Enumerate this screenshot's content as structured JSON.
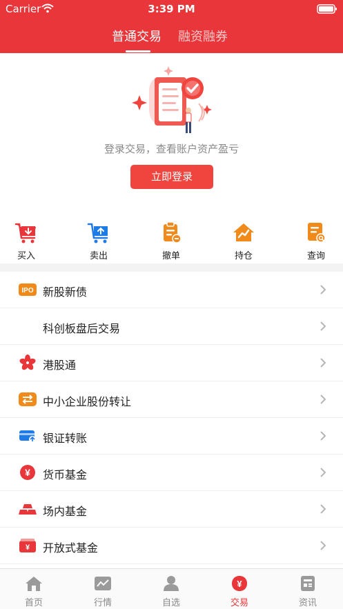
{
  "status_bar": {
    "carrier": "Carrier",
    "time": "3:39 PM"
  },
  "header": {
    "tabs": [
      {
        "label": "普通交易",
        "active": true
      },
      {
        "label": "融资融券",
        "active": false
      }
    ]
  },
  "login": {
    "message": "登录交易，查看账户资产盈亏",
    "button_label": "立即登录"
  },
  "quick_actions": [
    {
      "label": "买入",
      "icon": "cart-down-icon",
      "color": "#e8363a"
    },
    {
      "label": "卖出",
      "icon": "cart-up-icon",
      "color": "#1e7ae6"
    },
    {
      "label": "撤单",
      "icon": "clipboard-cancel-icon",
      "color": "#f08a1a"
    },
    {
      "label": "持仓",
      "icon": "house-chart-icon",
      "color": "#f08a1a"
    },
    {
      "label": "查询",
      "icon": "document-search-icon",
      "color": "#f08a1a"
    }
  ],
  "menu_items": [
    {
      "label": "新股新债",
      "icon": "ipo-icon",
      "icon_text": "IPO"
    },
    {
      "label": "科创板盘后交易",
      "icon": "none"
    },
    {
      "label": "港股通",
      "icon": "bauhinia-flower-icon"
    },
    {
      "label": "中小企业股份转让",
      "icon": "transfer-arrows-icon"
    },
    {
      "label": "银证转账",
      "icon": "bank-card-transfer-icon"
    },
    {
      "label": "货币基金",
      "icon": "yuan-coin-icon",
      "icon_text": "¥"
    },
    {
      "label": "场内基金",
      "icon": "gold-bars-icon"
    },
    {
      "label": "开放式基金",
      "icon": "yuan-wallet-icon",
      "icon_text": "¥"
    }
  ],
  "tab_bar": [
    {
      "label": "首页",
      "icon": "home-icon",
      "active": false
    },
    {
      "label": "行情",
      "icon": "market-chart-icon",
      "active": false
    },
    {
      "label": "自选",
      "icon": "person-icon",
      "active": false
    },
    {
      "label": "交易",
      "icon": "yuan-trade-icon",
      "icon_text": "¥",
      "active": true
    },
    {
      "label": "资讯",
      "icon": "news-icon",
      "active": false
    }
  ],
  "colors": {
    "brand_red": "#e8363a",
    "inactive_gray": "#888888"
  }
}
